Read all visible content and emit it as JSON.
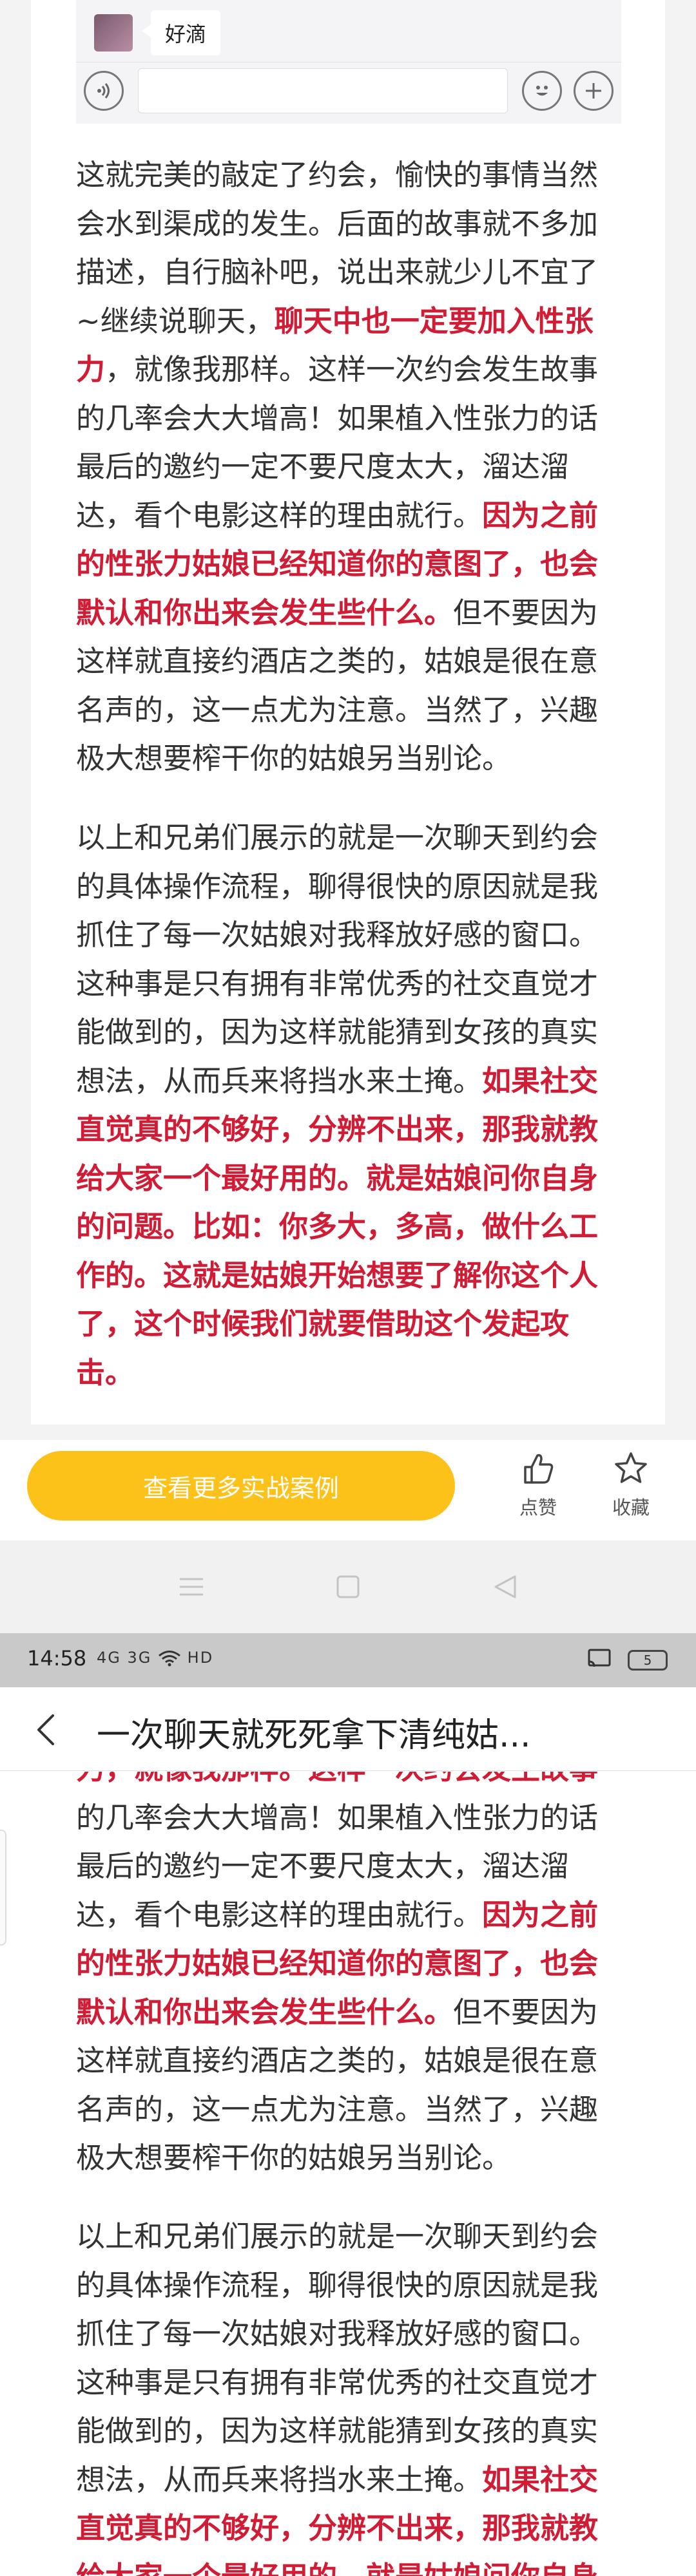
{
  "chat": {
    "message": "好滴",
    "voice_icon": "voice-icon",
    "emoji_icon": "emoji-icon",
    "plus_icon": "plus-icon"
  },
  "article": {
    "p1": {
      "t1": "这就完美的敲定了约会，愉快的事情当然会水到渠成的发生。后面的故事就不多加描述，自行脑补吧，说出来就少儿不宜了~继续说聊天，",
      "h1": "聊天中也一定要加入性张力",
      "t2": "，就像我那样。这样一次约会发生故事的几率会大大增高！如果植入性张力的话最后的邀约一定不要尺度太大，溜达溜达，看个电影这样的理由就行。",
      "h2": "因为之前的性张力姑娘已经知道你的意图了，也会默认和你出来会发生些什么。",
      "t3": "但不要因为这样就直接约酒店之类的，姑娘是很在意名声的，这一点尤为注意。当然了，兴趣极大想要榨干你的姑娘另当别论。"
    },
    "p2": {
      "t1": "以上和兄弟们展示的就是一次聊天到约会的具体操作流程，聊得很快的原因就是我抓住了每一次姑娘对我释放好感的窗口。这种事是只有拥有非常优秀的社交直觉才能做到的，因为这样就能猜到女孩的真实想法，从而兵来将挡水来土掩。",
      "h1": "如果社交直觉真的不够好，分辨不出来，那我就教给大家一个最好用的。就是姑娘问你自身的问题。比如：你多大，多高，做什么工作的。这就是姑娘开始想要了解你这个人了，这个时候我们就要借助这个发起攻击。"
    }
  },
  "lower_article": {
    "p1": {
      "partial": "力，就像我那样。这样一次约会发生故事",
      "t1": "的几率会大大增高！如果植入性张力的话最后的邀约一定不要尺度太大，溜达溜达，看个电影这样的理由就行。",
      "h1": "因为之前的性张力姑娘已经知道你的意图了，也会默认和你出来会发生些什么。",
      "t2": "但不要因为这样就直接约酒店之类的，姑娘是很在意名声的，这一点尤为注意。当然了，兴趣极大想要榨干你的姑娘另当别论。"
    },
    "p2": {
      "t1": "以上和兄弟们展示的就是一次聊天到约会的具体操作流程，聊得很快的原因就是我抓住了每一次姑娘对我释放好感的窗口。这种事是只有拥有非常优秀的社交直觉才能做到的，因为这样就能猜到女孩的真实想法，从而兵来将挡水来土掩。",
      "h1": "如果社交直觉真的不够好，分辨不出来，那我就教给大家一个最好用的。就是姑娘问你自身"
    }
  },
  "actions": {
    "cta_label": "查看更多实战案例",
    "like_label": "点赞",
    "like_icon": "thumbs-up-icon",
    "favorite_label": "收藏",
    "favorite_icon": "star-icon"
  },
  "nav": {
    "menu_icon": "menu-icon",
    "home_icon": "home-icon",
    "back_icon": "back-triangle-icon"
  },
  "status_bar": {
    "time": "14:58",
    "signal": "4G 3G",
    "network": "HD",
    "battery": "5"
  },
  "header": {
    "title": "一次聊天就死死拿下清纯姑...",
    "back_icon": "chevron-left-icon"
  },
  "colors": {
    "highlight": "#d11c36",
    "cta": "#fdc21a",
    "text": "#333333",
    "status_bar_bg": "#c9c9c9"
  }
}
